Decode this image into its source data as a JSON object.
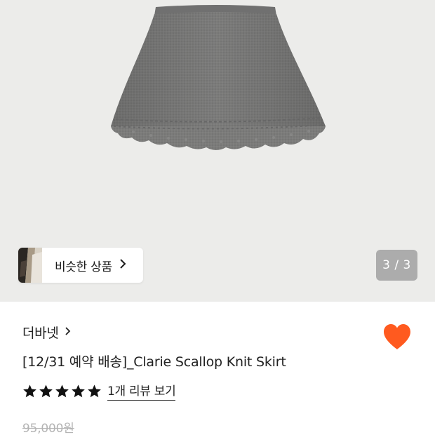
{
  "gallery": {
    "image_name": "gray-scallop-knit-skirt-photo",
    "similar_products_label": "비슷한 상품",
    "page_indicator": "3 / 3"
  },
  "product": {
    "brand": "더바넷",
    "title": "[12/31 예약 배송]_Clarie Scallop Knit Skirt",
    "rating_stars": 5,
    "review_link": "1개 리뷰 보기",
    "original_price": "95,000원",
    "liked": true
  },
  "colors": {
    "heart": "#ff5a1f",
    "star": "#111111",
    "price_strikethrough": "#b4b4b4",
    "image_background": "#ececea",
    "skirt": "#7a7a79"
  },
  "icons": {
    "similar_chevron": "chevron-right-icon",
    "brand_chevron": "chevron-right-icon",
    "heart": "heart-icon",
    "star": "star-icon"
  }
}
